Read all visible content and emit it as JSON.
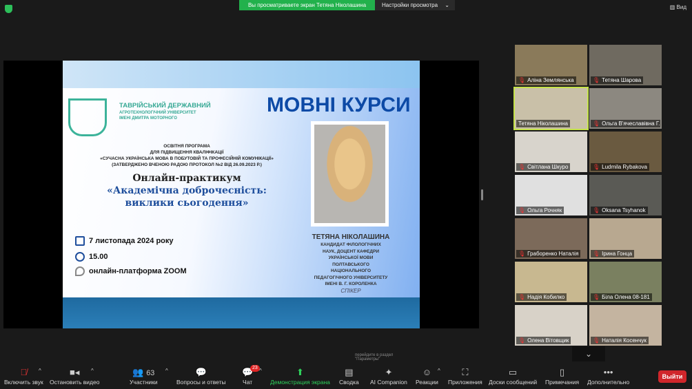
{
  "topbar": {
    "share_notice": "Вы просматриваете экран Тетяна Ніколашина",
    "view_settings": "Настройки просмотра",
    "view_button": "Вид"
  },
  "slide": {
    "title": "МОВНІ КУРСИ",
    "university": [
      "ТАВРІЙСЬКИЙ ДЕРЖАВНИЙ",
      "АГРОТЕХНОЛОГІЧНИЙ УНІВЕРСИТЕТ",
      "ІМЕНІ ДМИТРА МОТОРНОГО"
    ],
    "program": [
      "ОСВІТНЯ ПРОГРАМА",
      "ДЛЯ ПІДВИЩЕННЯ КВАЛІФІКАЦІЇ",
      "«СУЧАСНА УКРАЇНСЬКА МОВА В ПОБУТОВІЙ ТА ПРОФЕСІЙНІЙ КОМУНІКАЦІЇ»",
      "(ЗАТВЕРДЖЕНО ВЧЕНОЮ РАДОЮ ПРОТОКОЛ №2 ВІД 26.09.2023 Р.)"
    ],
    "workshop": [
      "Онлайн-практикум",
      "«Академічна доброчесність:",
      "виклики сьогодення»"
    ],
    "date": "7 листопада 2024 року",
    "time": "15.00",
    "platform": "онлайн-платформа ZOOM",
    "speaker_name": "ТЕТЯНА НІКОЛАШИНА",
    "speaker_info": [
      "КАНДИДАТ ФІЛОЛОГІЧНИХ",
      "НАУК, ДОЦЕНТ КАФЕДРИ",
      "УКРАЇНСЬКОЇ МОВИ",
      "ПОЛТАВСЬКОГО",
      "НАЦІОНАЛЬНОГО",
      "ПЕДАГОГІЧНОГО УНІВЕРСИТЕТУ",
      "ІМЕНІ В. Г. КОРОЛЕНКА"
    ],
    "speaker_role": "СПІКЕР",
    "tooltip": [
      "перейдите в раздел",
      "\"Параметры\""
    ]
  },
  "participants": [
    {
      "name": "Аліна Землянська",
      "muted": true
    },
    {
      "name": "Тетяна Шарова",
      "muted": true
    },
    {
      "name": "Тетяна Ніколашина",
      "muted": false,
      "active": true
    },
    {
      "name": "Ольга В'ячеславівна Г...",
      "muted": true
    },
    {
      "name": "Світлана Шкуро",
      "muted": true
    },
    {
      "name": "Ludmila Rybakova",
      "muted": true
    },
    {
      "name": "Ольга Рочняк",
      "muted": true
    },
    {
      "name": "Oksana Tsyhanok",
      "muted": true
    },
    {
      "name": "Граборенко Наталія",
      "muted": true
    },
    {
      "name": "Ірина Гонца",
      "muted": true
    },
    {
      "name": "Надія Кобилко",
      "muted": true
    },
    {
      "name": "Біла Олена 08-181",
      "muted": true
    },
    {
      "name": "Олена Вітовщик",
      "muted": true
    },
    {
      "name": "Наталія Косенчук",
      "muted": true
    }
  ],
  "toolbar": {
    "unmute": "Включить звук",
    "stop_video": "Остановить видео",
    "participants": "Участники",
    "participants_count": "63",
    "qa": "Вопросы и ответы",
    "chat": "Чат",
    "chat_badge": "23",
    "share": "Демонстрация экрана",
    "summary": "Сводка",
    "ai": "AI Companion",
    "reactions": "Реакции",
    "apps": "Приложения",
    "whiteboards": "Доски сообщений",
    "notes": "Примечания",
    "more": "Дополнительно",
    "leave": "Выйти"
  }
}
